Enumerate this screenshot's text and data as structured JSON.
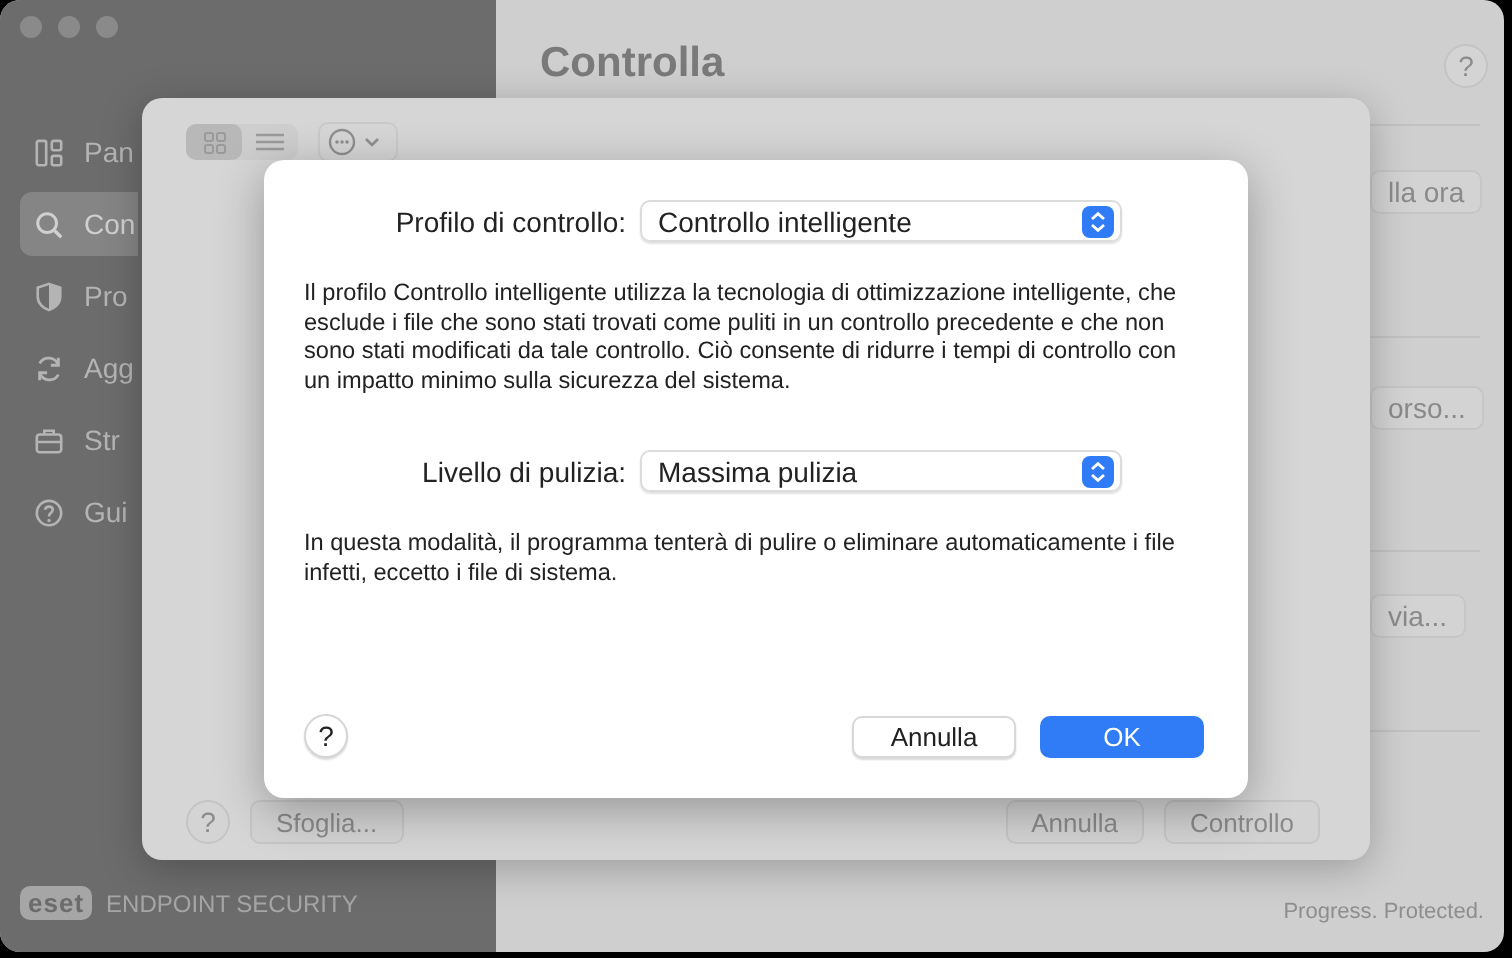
{
  "main_window": {
    "title": "Controlla",
    "sidebar": {
      "items": [
        {
          "label": "Pan",
          "selected": false
        },
        {
          "label": "Con",
          "selected": true
        },
        {
          "label": "Pro",
          "selected": false
        },
        {
          "label": "Agg",
          "selected": false
        },
        {
          "label": "Str",
          "selected": false
        },
        {
          "label": "Gui",
          "selected": false
        }
      ]
    },
    "help_button": "?",
    "right_buttons": [
      "lla ora",
      "orso...",
      "via..."
    ],
    "logo": {
      "mark": "eset",
      "product": "ENDPOINT SECURITY"
    },
    "tagline": "Progress. Protected."
  },
  "sheet": {
    "view_toggle": [
      {
        "selected": true
      },
      {
        "selected": false
      }
    ],
    "help_button": "?",
    "buttons_left": [
      "Sfoglia..."
    ],
    "buttons_right": [
      "Annulla",
      "Controllo"
    ]
  },
  "dialog": {
    "rows": [
      {
        "label": "Profilo di controllo:",
        "value": "Controllo intelligente",
        "description": "Il profilo Controllo intelligente utilizza la tecnologia di ottimizzazione intelligente, che esclude i file che sono stati trovati come puliti in un controllo precedente e che non sono stati modificati da tale controllo. Ciò consente di ridurre i tempi di controllo con un impatto minimo sulla sicurezza del sistema."
      },
      {
        "label": "Livello di pulizia:",
        "value": "Massima pulizia",
        "description": "In questa modalità, il programma tenterà di pulire o eliminare automaticamente i file infetti, eccetto i file di sistema."
      }
    ],
    "help_button": "?",
    "cancel": "Annulla",
    "ok": "OK"
  }
}
